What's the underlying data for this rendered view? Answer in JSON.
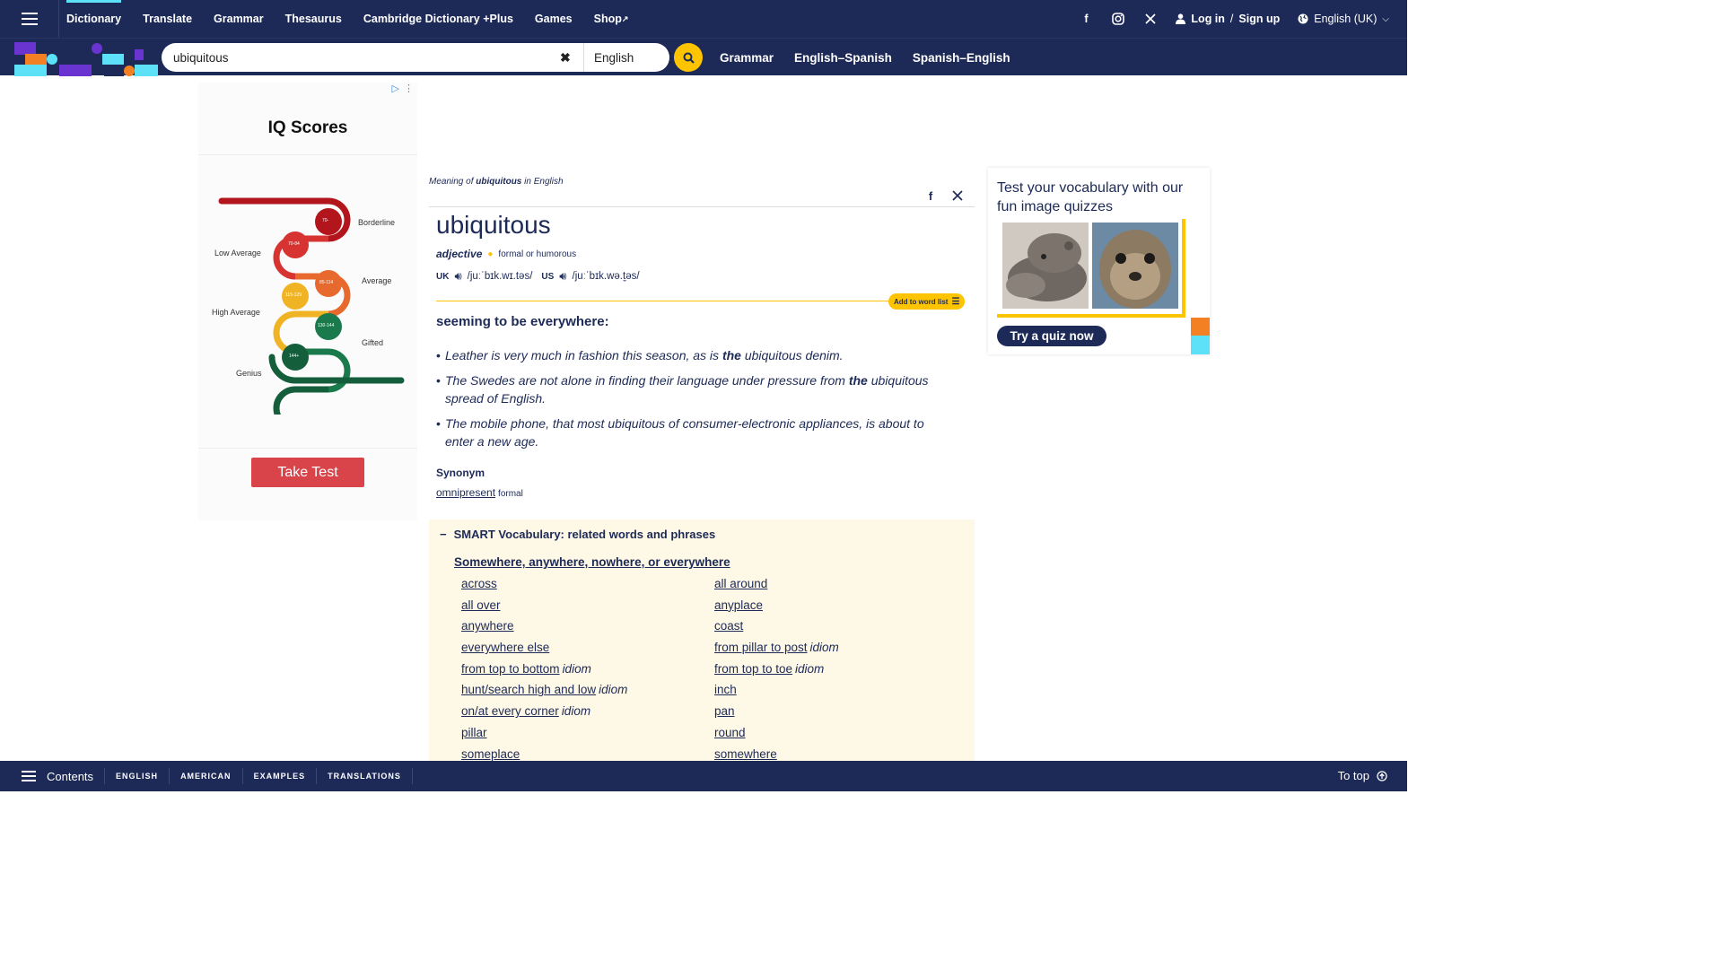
{
  "topnav": {
    "items": [
      "Dictionary",
      "Translate",
      "Grammar",
      "Thesaurus",
      "Cambridge Dictionary +Plus",
      "Games",
      "Shop"
    ],
    "login": "Log in",
    "login_sep": "/",
    "signup": "Sign up",
    "language": "English (UK)"
  },
  "search": {
    "value": "ubiquitous",
    "dictionary": "English",
    "links": [
      "Grammar",
      "English–Spanish",
      "Spanish–English"
    ]
  },
  "ad": {
    "title": "IQ Scores",
    "labels": [
      "Borderline",
      "Low Average",
      "Average",
      "High Average",
      "Gifted",
      "Genius"
    ],
    "bands": [
      "70-",
      "70-84",
      "85-114",
      "115-129",
      "130-144",
      "144+"
    ],
    "button": "Take Test"
  },
  "entry": {
    "meaning_prefix": "Meaning of",
    "meaning_word": "ubiquitous",
    "meaning_suffix": "in English",
    "headword": "ubiquitous",
    "pos": "adjective",
    "usage": "formal or humorous",
    "uk_label": "UK",
    "uk_ipa": "/juːˈbɪk.wɪ.təs/",
    "us_label": "US",
    "us_ipa": "/juːˈbɪk.wə.t̬əs/",
    "add_to_list": "Add to word list",
    "definition": "seeming to be everywhere:",
    "examples": [
      {
        "before": "Leather is very much in fashion this season, as is ",
        "bold": "the",
        "after": " ubiquitous denim."
      },
      {
        "before": "The Swedes are not alone in finding their language under pressure from ",
        "bold": "the",
        "after": " ubiquitous spread of English."
      },
      {
        "before": "The mobile phone, that most ubiquitous of consumer-electronic appliances, is about to enter a new age.",
        "bold": "",
        "after": ""
      }
    ],
    "synonym_label": "Synonym",
    "synonym": "omnipresent",
    "synonym_register": "formal"
  },
  "smart": {
    "heading": "SMART Vocabulary: related words and phrases",
    "collapse_symbol": "−",
    "subheading": "Somewhere, anywhere, nowhere, or everywhere",
    "items": [
      {
        "word": "across",
        "tag": ""
      },
      {
        "word": "all around",
        "tag": ""
      },
      {
        "word": "all over",
        "tag": ""
      },
      {
        "word": "anyplace",
        "tag": ""
      },
      {
        "word": "anywhere",
        "tag": ""
      },
      {
        "word": "coast",
        "tag": ""
      },
      {
        "word": "everywhere else",
        "tag": ""
      },
      {
        "word": "from pillar to post",
        "tag": "idiom"
      },
      {
        "word": "from top to bottom",
        "tag": "idiom"
      },
      {
        "word": "from top to toe",
        "tag": "idiom"
      },
      {
        "word": "hunt/search high and low",
        "tag": "idiom"
      },
      {
        "word": "inch",
        "tag": ""
      },
      {
        "word": "on/at every corner",
        "tag": "idiom"
      },
      {
        "word": "pan",
        "tag": ""
      },
      {
        "word": "pillar",
        "tag": ""
      },
      {
        "word": "round",
        "tag": ""
      },
      {
        "word": "someplace",
        "tag": ""
      },
      {
        "word": "somewhere",
        "tag": ""
      }
    ]
  },
  "quiz": {
    "title": "Test your vocabulary with our fun image quizzes",
    "button": "Try a quiz now"
  },
  "bottombar": {
    "contents": "Contents",
    "links": [
      "ENGLISH",
      "AMERICAN",
      "EXAMPLES",
      "TRANSLATIONS"
    ],
    "to_top": "To top"
  },
  "colors": {
    "navy": "#1d2a57",
    "yellow": "#fec400",
    "cyan": "#5ce1f8",
    "orange": "#f48024",
    "purple": "#6a34d0",
    "ad_red": "#d9444a"
  }
}
